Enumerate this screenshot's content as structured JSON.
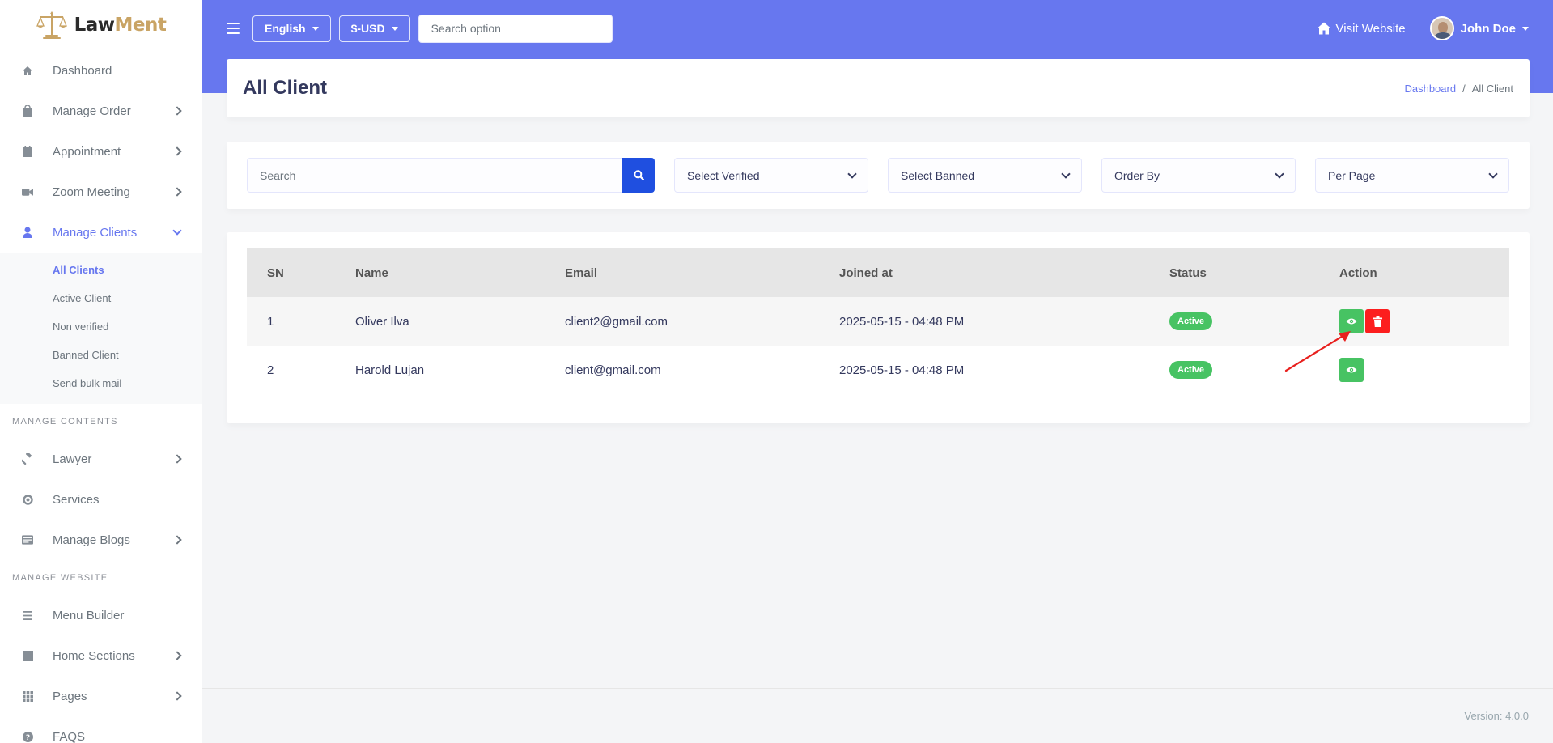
{
  "brand": {
    "part1": "Law",
    "part2": "Ment"
  },
  "sidebar": {
    "items": [
      {
        "label": "Dashboard"
      },
      {
        "label": "Manage Order"
      },
      {
        "label": "Appointment"
      },
      {
        "label": "Zoom Meeting"
      },
      {
        "label": "Manage Clients"
      }
    ],
    "submenu": [
      "All Clients",
      "Active Client",
      "Non verified",
      "Banned Client",
      "Send bulk mail"
    ],
    "sections": [
      {
        "header": "MANAGE CONTENTS",
        "items": [
          "Lawyer",
          "Services",
          "Manage Blogs"
        ]
      },
      {
        "header": "MANAGE WEBSITE",
        "items": [
          "Menu Builder",
          "Home Sections",
          "Pages",
          "FAQS"
        ]
      }
    ]
  },
  "topbar": {
    "language": "English",
    "currency": "$-USD",
    "search_placeholder": "Search option",
    "visit_website": "Visit Website",
    "user_name": "John Doe"
  },
  "header": {
    "title": "All Client",
    "breadcrumb": {
      "link": "Dashboard",
      "sep": "/",
      "current": "All Client"
    }
  },
  "filters": {
    "search_placeholder": "Search",
    "verified": "Select Verified",
    "banned": "Select Banned",
    "order_by": "Order By",
    "per_page": "Per Page"
  },
  "table": {
    "columns": [
      "SN",
      "Name",
      "Email",
      "Joined at",
      "Status",
      "Action"
    ],
    "rows": [
      {
        "sn": "1",
        "name": "Oliver Ilva",
        "email": "client2@gmail.com",
        "joined": "2025-05-15 - 04:48 PM",
        "status": "Active"
      },
      {
        "sn": "2",
        "name": "Harold Lujan",
        "email": "client@gmail.com",
        "joined": "2025-05-15 - 04:48 PM",
        "status": "Active"
      }
    ]
  },
  "footer": {
    "version": "Version: 4.0.0"
  },
  "colors": {
    "primary": "#6777ef",
    "success": "#47c363",
    "danger": "#fc1e1e",
    "search_button": "#1f4fe0",
    "brand_gold": "#c9a465"
  }
}
